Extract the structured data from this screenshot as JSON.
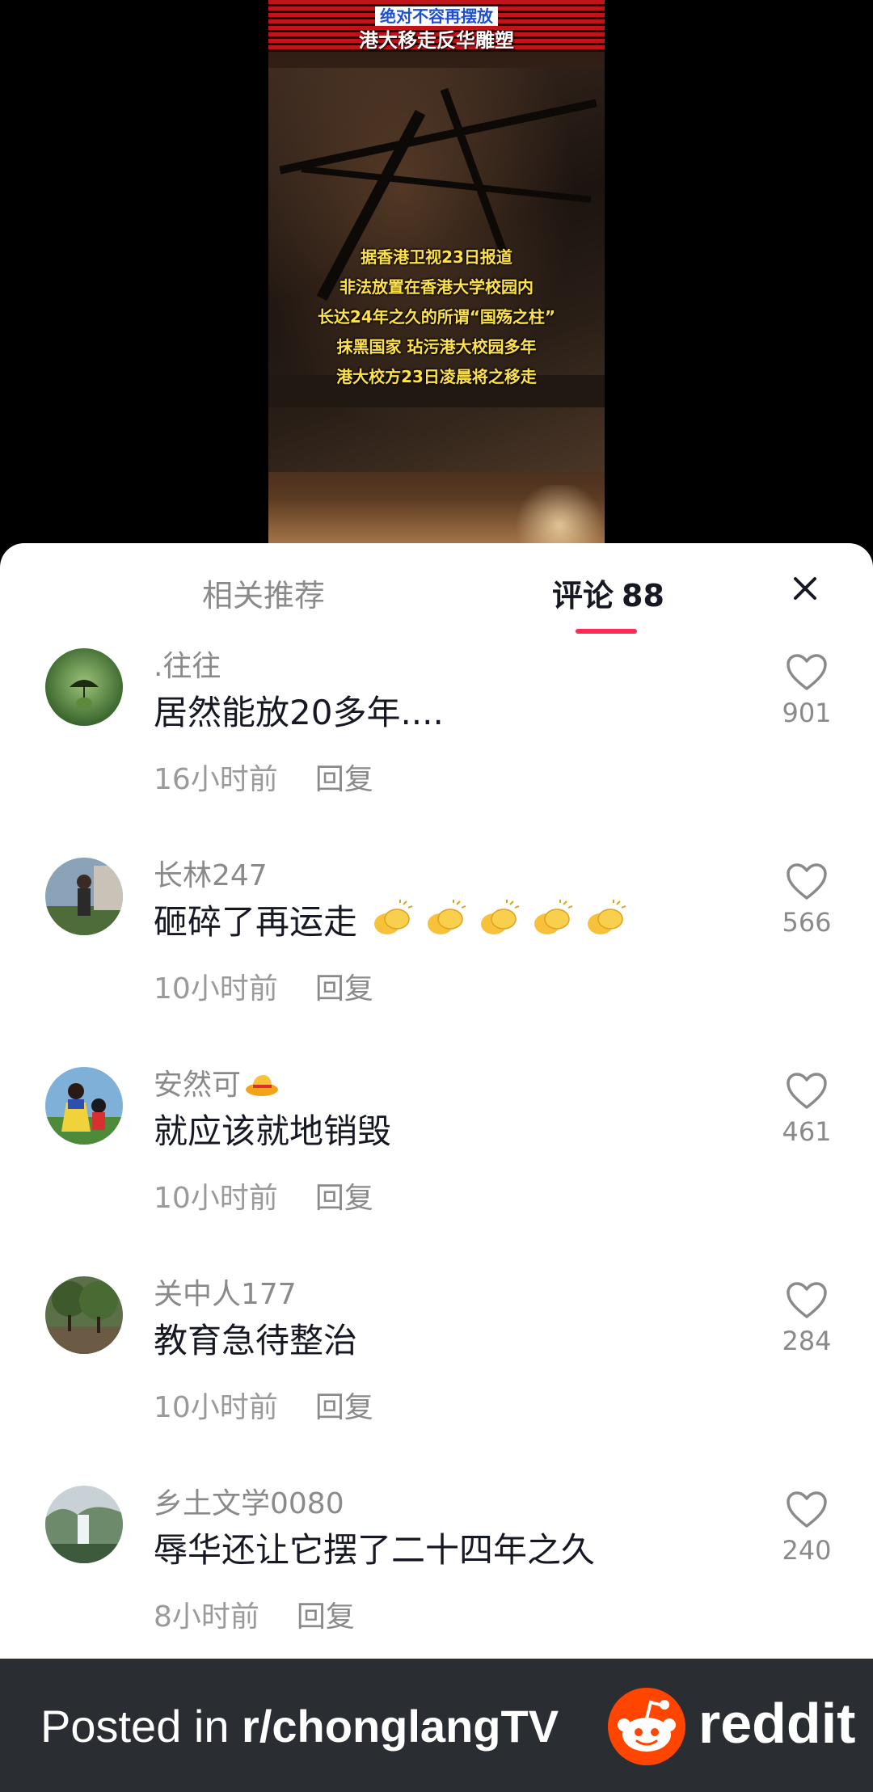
{
  "video": {
    "banner_line1": "绝对不容再摆放",
    "banner_line2": "港大移走反华雕塑",
    "captions": [
      "据香港卫视23日报道",
      "非法放置在香港大学校园内",
      "长达24年之久的所谓“国殇之柱”",
      "抹黑国家 玷污港大校园多年",
      "港大校方23日凌晨将之移走"
    ]
  },
  "sheet": {
    "tab_related": "相关推荐",
    "tab_comments": "评论",
    "comment_count": "88",
    "accent_color": "#fe2c55",
    "close_icon": "close-icon"
  },
  "comments": [
    {
      "username": ".往往",
      "text": "居然能放20多年....",
      "time": "16小时前",
      "reply": "回复",
      "likes": "901"
    },
    {
      "username": "长林247",
      "text": "砸碎了再运走",
      "emoji": "clapping-hands x5",
      "time": "10小时前",
      "reply": "回复",
      "likes": "566"
    },
    {
      "username": "安然可",
      "username_emoji": "hat",
      "text": "就应该就地销毁",
      "time": "10小时前",
      "reply": "回复",
      "likes": "461"
    },
    {
      "username": "关中人177",
      "text": "教育急待整治",
      "time": "10小时前",
      "reply": "回复",
      "likes": "284"
    },
    {
      "username": "乡土文学0080",
      "text": "辱华还让它摆了二十四年之久",
      "time": "8小时前",
      "reply": "回复",
      "likes": "240"
    }
  ],
  "footer": {
    "posted_prefix": "Posted in ",
    "subreddit": "r/chonglangTV",
    "brand": "reddit",
    "brand_color": "#ff4500"
  }
}
